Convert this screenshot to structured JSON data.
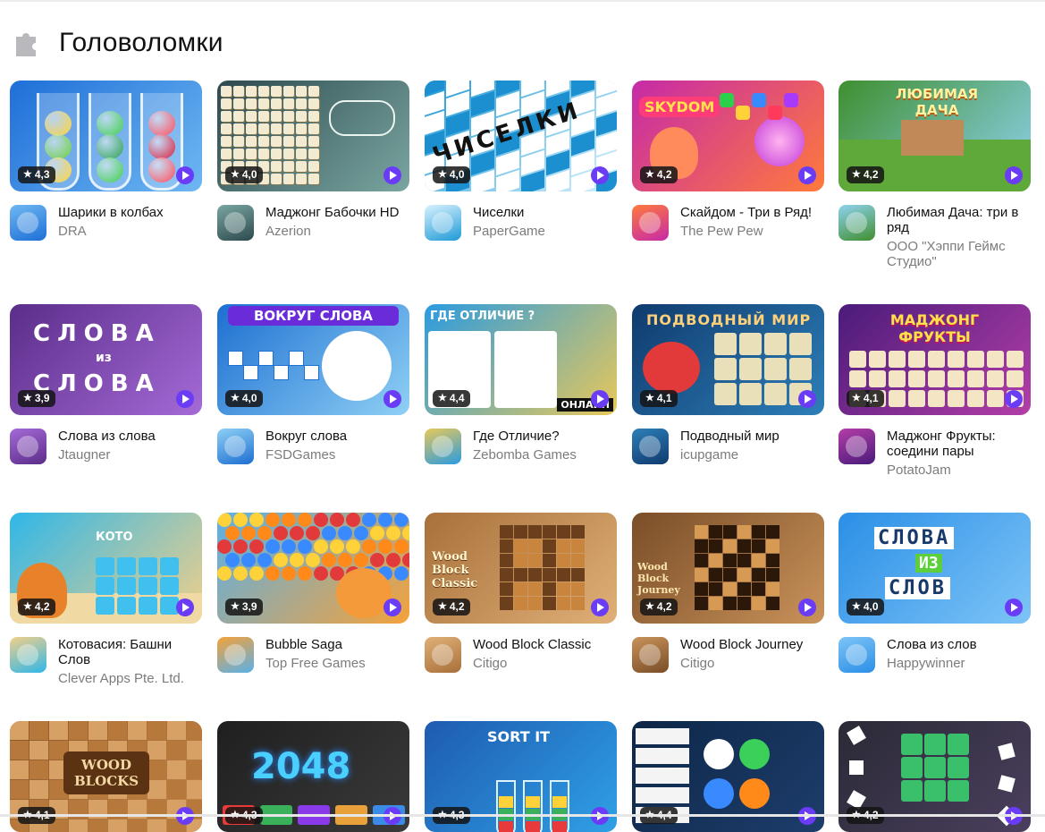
{
  "section": {
    "title": "Головоломки",
    "icon": "puzzle-icon"
  },
  "games": [
    {
      "title": "Шарики в колбах",
      "developer": "DRA",
      "rating": "4,3",
      "colors": [
        "#1e6fd8",
        "#6fb7f2"
      ]
    },
    {
      "title": "Маджонг Бабочки HD",
      "developer": "Azerion",
      "rating": "4,0",
      "colors": [
        "#2d4a4e",
        "#7aa6a1"
      ]
    },
    {
      "title": "Чиселки",
      "developer": "PaperGame",
      "rating": "4,0",
      "colors": [
        "#1e9ad6",
        "#d9f2ff"
      ]
    },
    {
      "title": "Скайдом - Три в Ряд!",
      "developer": "The Pew Pew",
      "rating": "4,2",
      "colors": [
        "#c62aa8",
        "#ff7a3c"
      ]
    },
    {
      "title": "Любимая Дача: три в ряд",
      "developer": "ООО \"Хэппи Геймс Студио\"",
      "rating": "4,2",
      "colors": [
        "#3f8f2f",
        "#8fd2f0"
      ]
    },
    {
      "title": "Слова из слова",
      "developer": "Jtaugner",
      "rating": "3,9",
      "colors": [
        "#5b2d8a",
        "#a46ad6"
      ]
    },
    {
      "title": "Вокруг слова",
      "developer": "FSDGames",
      "rating": "4,0",
      "colors": [
        "#1d6fd1",
        "#8fd0f5"
      ]
    },
    {
      "title": "Где Отличие?",
      "developer": "Zebomba Games",
      "rating": "4,4",
      "colors": [
        "#2a9be0",
        "#e8c85a"
      ]
    },
    {
      "title": "Подводный мир",
      "developer": "icupgame",
      "rating": "4,1",
      "colors": [
        "#0f3b6e",
        "#2e7fb8"
      ]
    },
    {
      "title": "Маджонг Фрукты: соедини пары",
      "developer": "PotatoJam",
      "rating": "4,1",
      "colors": [
        "#4a1b7a",
        "#b43ea8"
      ]
    },
    {
      "title": "Котовасия: Башни Слов",
      "developer": "Clever Apps Pte. Ltd.",
      "rating": "4,2",
      "colors": [
        "#2fb7e8",
        "#f2d08a"
      ]
    },
    {
      "title": "Bubble Saga",
      "developer": "Top Free Games",
      "rating": "3,9",
      "colors": [
        "#5ab0e8",
        "#f4a23a"
      ]
    },
    {
      "title": "Wood Block Classic",
      "developer": "Citigo",
      "rating": "4,2",
      "colors": [
        "#a8703a",
        "#e0b078"
      ]
    },
    {
      "title": "Wood Block Journey",
      "developer": "Citigo",
      "rating": "4,2",
      "colors": [
        "#7a4e28",
        "#c9925a"
      ]
    },
    {
      "title": "Слова из слов",
      "developer": "Happywinner",
      "rating": "4,0",
      "colors": [
        "#2b8fe6",
        "#7dc4f7"
      ]
    },
    {
      "title": "",
      "developer": "",
      "rating": "4,1",
      "colors": [
        "#8a5528",
        "#c58a4e"
      ]
    },
    {
      "title": "",
      "developer": "",
      "rating": "4,3",
      "colors": [
        "#1f1f1f",
        "#3a3a3a"
      ]
    },
    {
      "title": "",
      "developer": "",
      "rating": "4,3",
      "colors": [
        "#1e5bb0",
        "#2fa0e6"
      ]
    },
    {
      "title": "",
      "developer": "",
      "rating": "4,4",
      "colors": [
        "#0e2748",
        "#1d3d6b"
      ]
    },
    {
      "title": "",
      "developer": "",
      "rating": "4,2",
      "colors": [
        "#2a2a36",
        "#4b3f5e"
      ]
    }
  ],
  "thumb_text": {
    "g2": "ЧИСЕЛКИ",
    "g3": "SKYDOM",
    "g4": "ЛЮБИМАЯ ДАЧА",
    "g5a": "СЛОВА",
    "g5b": "из",
    "g5c": "СЛОВА",
    "g6": "ВОКРУГ СЛОВА",
    "g7a": "ГДЕ ОТЛИЧИЕ ?",
    "g7b": "ОНЛАЙН",
    "g8": "ПОДВОДНЫЙ МИР",
    "g9": "МАДЖОНГ ФРУКТЫ",
    "g10": "КОТО",
    "g12": "Wood Block Classic",
    "g13": "Wood Block Journey",
    "g14a": "СЛОВА",
    "g14b": "ИЗ",
    "g14c": "СЛОВ",
    "g15": "WOOD BLOCKS",
    "g16": "2048",
    "g17": "SORT IT"
  },
  "accent_color": "#6a3cf5"
}
